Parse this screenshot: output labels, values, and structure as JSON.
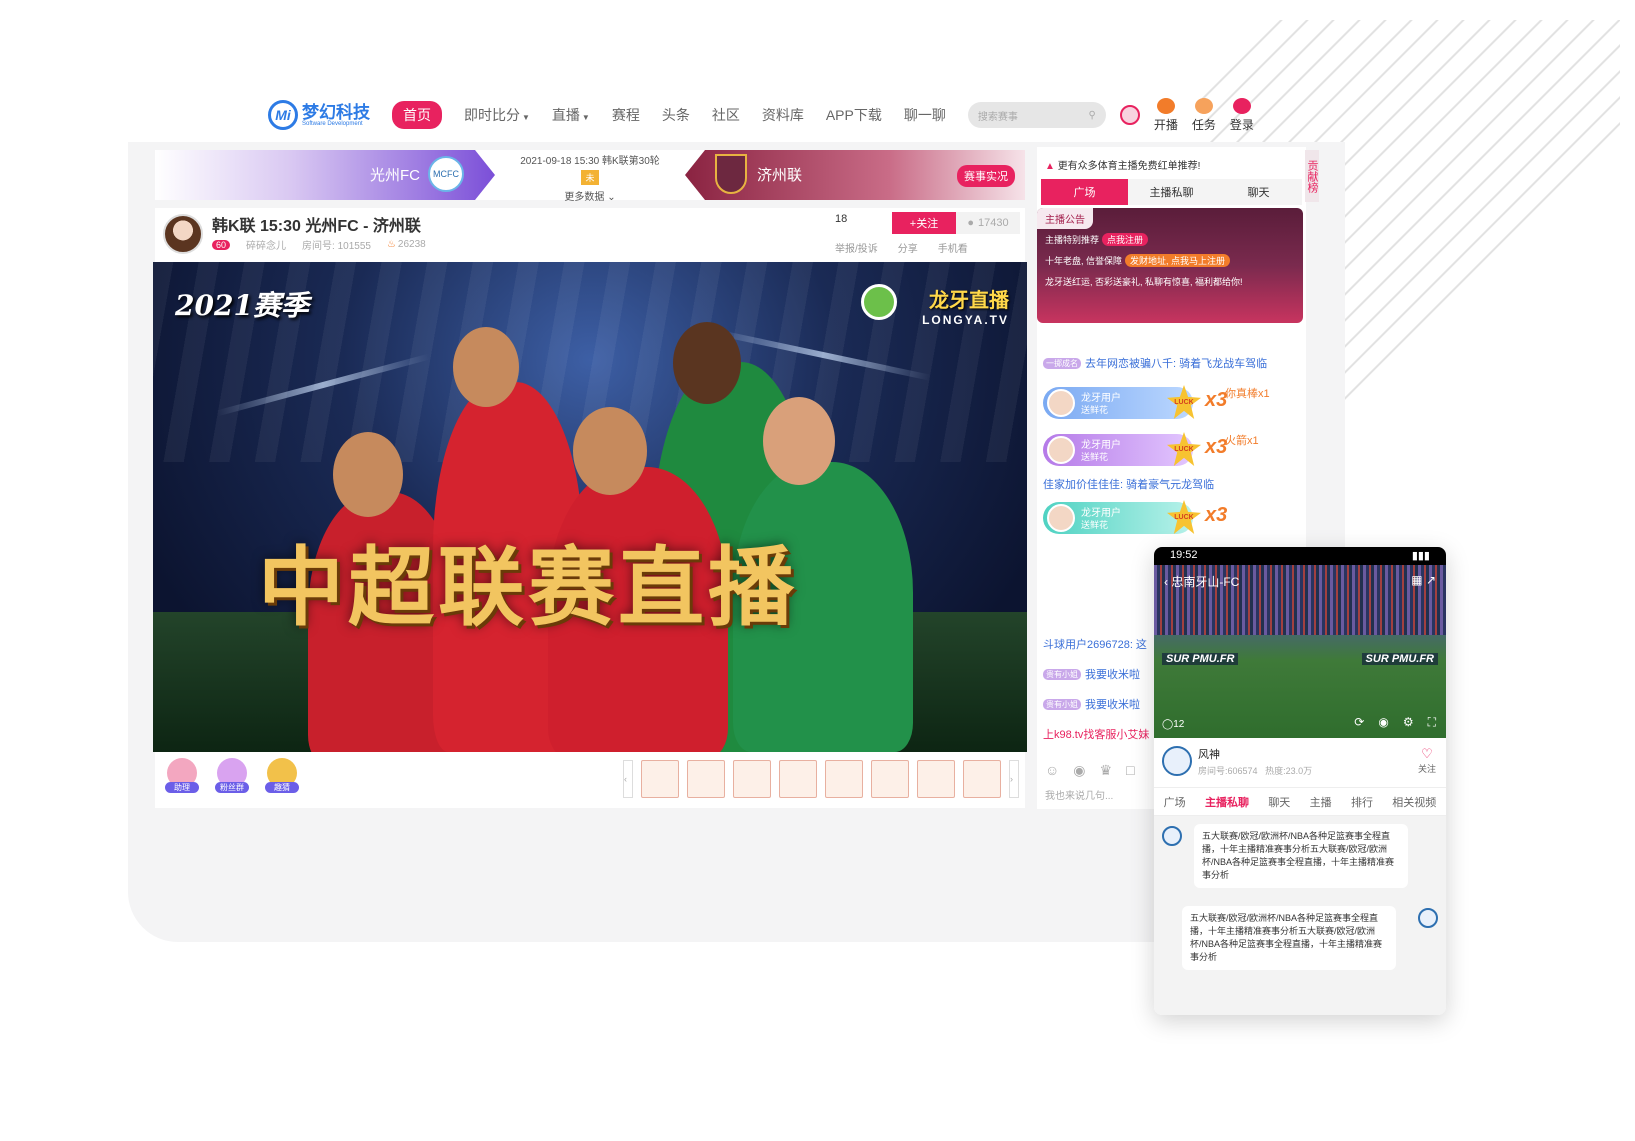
{
  "nav": {
    "logo_cn": "梦幻科技",
    "logo_en": "Software Development",
    "logo_mark": "Mi",
    "items": [
      {
        "label": "首页",
        "active": true,
        "caret": false
      },
      {
        "label": "即时比分",
        "active": false,
        "caret": true
      },
      {
        "label": "直播",
        "active": false,
        "caret": true
      },
      {
        "label": "赛程",
        "active": false,
        "caret": false
      },
      {
        "label": "头条",
        "active": false,
        "caret": false
      },
      {
        "label": "社区",
        "active": false,
        "caret": false
      },
      {
        "label": "资料库",
        "active": false,
        "caret": false
      },
      {
        "label": "APP下载",
        "active": false,
        "caret": false
      },
      {
        "label": "聊一聊",
        "active": false,
        "caret": false
      }
    ],
    "search_placeholder": "搜索赛事",
    "icons": [
      {
        "label": "开播",
        "icon": "broadcast-icon"
      },
      {
        "label": "任务",
        "icon": "task-icon"
      },
      {
        "label": "登录",
        "icon": "user-icon"
      }
    ]
  },
  "match": {
    "home": "光州FC",
    "away": "济州联",
    "info": "2021-09-18 15:30 韩K联第30轮",
    "status": "未",
    "more": "更多数据",
    "report": "赛事实况"
  },
  "stream": {
    "title": "韩K联 15:30 光州FC - 济州联",
    "level": "60",
    "anchor": "碎碎念儿",
    "room": "房间号: 101555",
    "heat": "26238",
    "viewers": "18",
    "follow": "+关注",
    "follow_count": "17430",
    "actions": [
      "举报/投诉",
      "分享",
      "手机看"
    ]
  },
  "video": {
    "season": "2021赛季",
    "brand_cn": "龙牙直播",
    "brand_en": "LONGYA.TV",
    "headline": "中超联赛直播"
  },
  "tools": [
    {
      "label": "助理"
    },
    {
      "label": "粉丝群"
    },
    {
      "label": "趣猜"
    }
  ],
  "sidebar": {
    "notice": "更有众多体育主播免费红单推荐!",
    "tabs": [
      {
        "label": "广场",
        "active": true
      },
      {
        "label": "主播私聊",
        "active": false
      },
      {
        "label": "聊天",
        "active": false
      }
    ],
    "contrib": "贡献榜",
    "announce": {
      "tag": "主播公告",
      "line1": "主播特别推荐",
      "line1_pill": "点我注册",
      "line2": "十年老盘, 信誉保障",
      "line2_pill": "发财地址, 点我马上注册",
      "line3": "龙牙送红运, 否彩送豪礼, 私聊有惊喜, 福利都给你!"
    },
    "chat": [
      {
        "text": "去年网恋被骗八千: 骑着飞龙战车驾临",
        "lv": "一掷成名"
      },
      {
        "text": "佳家加价佳佳佳: 骑着豪气元龙驾临",
        "lv": ""
      },
      {
        "text": "斗球用户2696728: 这",
        "lv": ""
      },
      {
        "text": "我要收米啦",
        "lv": "贵有小姐"
      },
      {
        "text": "我要收米啦",
        "lv": "贵有小姐"
      },
      {
        "text": "上k98.tv找客服小艾妹",
        "lv": ""
      }
    ],
    "luck": [
      {
        "name": "龙牙用户",
        "sub": "送鲜花",
        "times": "x3",
        "extra": "你真棒x1"
      },
      {
        "name": "龙牙用户",
        "sub": "送鲜花",
        "times": "x3",
        "extra": "火箭x1"
      },
      {
        "name": "龙牙用户",
        "sub": "送鲜花",
        "times": "x3",
        "extra": ""
      }
    ],
    "luck_label": "LUCK",
    "input_placeholder": "我也来说几句..."
  },
  "phone": {
    "time": "19:52",
    "title": "忠南牙山-FC",
    "ad": "SUR PMU.FR",
    "viewers": "12",
    "anchor": "风神",
    "room": "房间号:606574",
    "heat": "热度:23.0万",
    "follow": "关注",
    "tabs": [
      {
        "label": "广场",
        "active": false
      },
      {
        "label": "主播私聊",
        "active": true
      },
      {
        "label": "聊天",
        "active": false
      },
      {
        "label": "主播",
        "active": false
      },
      {
        "label": "排行",
        "active": false
      },
      {
        "label": "相关视频",
        "active": false
      }
    ],
    "msg1": "五大联赛/欧冠/欧洲杯/NBA各种足篮赛事全程直播，十年主播精准赛事分析五大联赛/欧冠/欧洲杯/NBA各种足篮赛事全程直播，十年主播精准赛事分析",
    "msg2": "五大联赛/欧冠/欧洲杯/NBA各种足篮赛事全程直播，十年主播精准赛事分析五大联赛/欧冠/欧洲杯/NBA各种足篮赛事全程直播，十年主播精准赛事分析"
  },
  "colors": {
    "accent": "#e8225f",
    "brand": "#2d7be5"
  }
}
